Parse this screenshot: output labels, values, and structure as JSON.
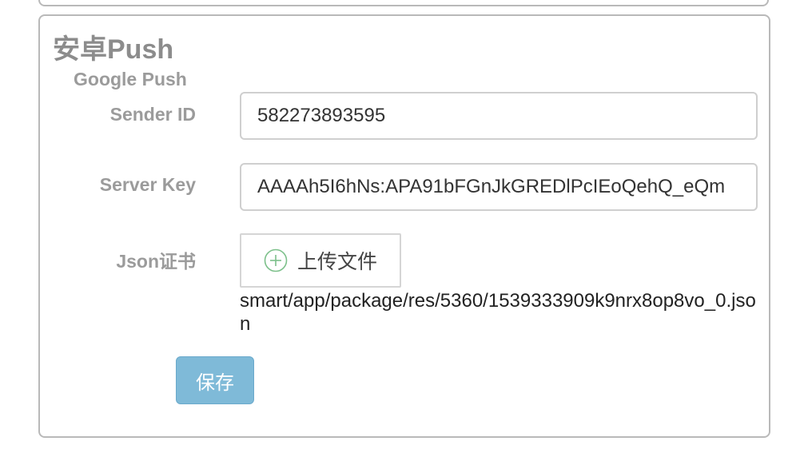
{
  "panel": {
    "title": "安卓Push",
    "section_label": "Google Push"
  },
  "fields": {
    "sender_id": {
      "label": "Sender ID",
      "value": "582273893595"
    },
    "server_key": {
      "label": "Server Key",
      "value": "AAAAh5I6hNs:APA91bFGnJkGREDlPcIEoQehQ_eQm"
    },
    "json_cert": {
      "label": "Json证书",
      "upload_label": "上传文件",
      "upload_icon": "plus-circle-icon",
      "file_path": "smart/app/package/res/5360/1539333909k9nrx8op8vo_0.json"
    }
  },
  "actions": {
    "save_label": "保存",
    "save_color": "#7fbad8"
  }
}
